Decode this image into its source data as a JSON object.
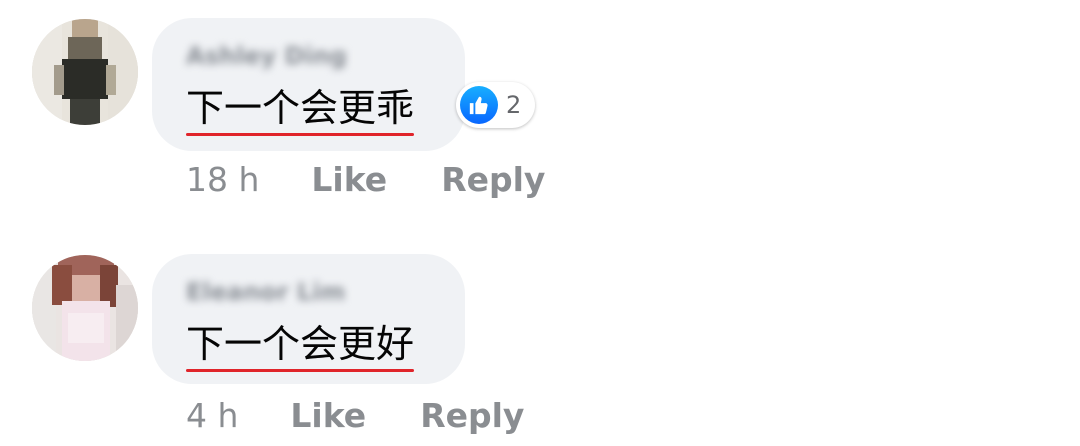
{
  "comments": [
    {
      "author": "Ashley Ding",
      "text": "下一个会更乖",
      "timestamp": "18 h",
      "like_label": "Like",
      "reply_label": "Reply",
      "reaction": {
        "icon": "thumbs-up-icon",
        "count": "2"
      }
    },
    {
      "author": "Eleanor Lim",
      "text": "下一个会更好",
      "timestamp": "4 h",
      "like_label": "Like",
      "reply_label": "Reply"
    }
  ],
  "colors": {
    "bubble": "#f0f2f5",
    "underline": "#e0242a",
    "like_blue": "#0866ff",
    "secondary_text": "#8a8d91"
  }
}
